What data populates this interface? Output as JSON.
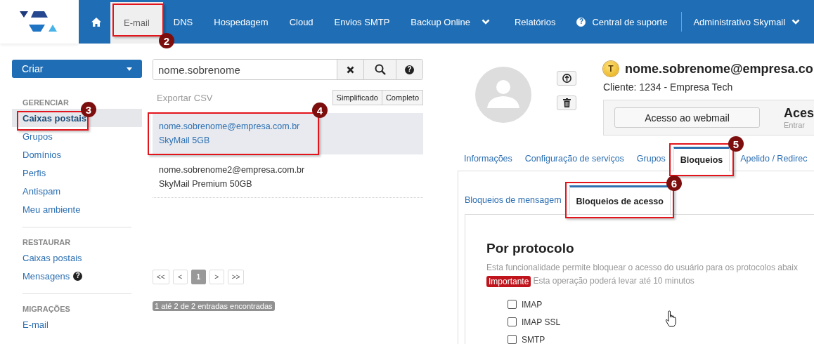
{
  "nav": {
    "items": [
      {
        "kind": "home",
        "selected": false
      },
      {
        "kind": "text",
        "label": "E-mail",
        "selected": true,
        "dropdown": false
      },
      {
        "kind": "text",
        "label": "DNS",
        "selected": false,
        "dropdown": false
      },
      {
        "kind": "text",
        "label": "Hospedagem",
        "selected": false,
        "dropdown": false
      },
      {
        "kind": "text",
        "label": "Cloud",
        "selected": false,
        "dropdown": false
      },
      {
        "kind": "text",
        "label": "Envios SMTP",
        "selected": false,
        "dropdown": false
      },
      {
        "kind": "text",
        "label": "Backup Online",
        "selected": false,
        "dropdown": true
      },
      {
        "kind": "text",
        "label": "Relatórios",
        "selected": false,
        "dropdown": false
      },
      {
        "kind": "help",
        "icon": "?",
        "label": "Central de suporte",
        "selected": false,
        "dropdown": false
      }
    ],
    "account": {
      "label": "Administrativo Skymail",
      "dropdown": true
    }
  },
  "sidebar": {
    "create_button": "Criar",
    "sections": [
      {
        "title": "GERENCIAR",
        "items": [
          {
            "label": "Caixas postais",
            "selected": true
          },
          {
            "label": "Grupos",
            "selected": false
          },
          {
            "label": "Domínios",
            "selected": false
          },
          {
            "label": "Perfis",
            "selected": false
          },
          {
            "label": "Antispam",
            "selected": false
          },
          {
            "label": "Meu ambiente",
            "selected": false
          }
        ]
      },
      {
        "title": "RESTAURAR",
        "items": [
          {
            "label": "Caixas postais",
            "selected": false
          },
          {
            "label": "Mensagens",
            "selected": false,
            "help": "?"
          }
        ]
      },
      {
        "title": "MIGRAÇÕES",
        "items": [
          {
            "label": "E-mail",
            "selected": false
          }
        ]
      }
    ]
  },
  "mailbox_list": {
    "search": {
      "value": "nome.sobrenome",
      "help_button": "?"
    },
    "export_link": "Exportar CSV",
    "view_buttons": [
      "Simplificado",
      "Completo"
    ],
    "rows": [
      {
        "email": "nome.sobrenome@empresa.com.br",
        "plan": "SkyMail 5GB",
        "selected": true
      },
      {
        "email": "nome.sobrenome2@empresa.com.br",
        "plan": "SkyMail Premium 50GB",
        "selected": false
      }
    ],
    "pagination": [
      {
        "label": "<<",
        "selected": false
      },
      {
        "label": "<",
        "selected": false
      },
      {
        "label": "1",
        "selected": true
      },
      {
        "label": ">",
        "selected": false
      },
      {
        "label": ">>",
        "selected": false
      }
    ],
    "count": "1 até 2 de 2 entradas encontradas"
  },
  "detail": {
    "status_badge": "T",
    "title": "nome.sobrenome@empresa.co",
    "client": "Cliente: 1234 - Empresa Tech",
    "webmail_button": "Acesso ao webmail",
    "access_title": "Aces",
    "access_subtitle": "Entrar",
    "tabs": [
      {
        "label": "Informações",
        "selected": false
      },
      {
        "label": "Configuração de serviços",
        "selected": false
      },
      {
        "label": "Grupos",
        "selected": false
      },
      {
        "label": "Bloqueios",
        "selected": true
      },
      {
        "label": "Apelido / Redirec",
        "selected": false
      }
    ],
    "subtabs": [
      {
        "label": "Bloqueios de mensagem",
        "selected": false
      },
      {
        "label": "Bloqueios de acesso",
        "selected": true
      }
    ],
    "section": {
      "heading": "Por protocolo",
      "description": "Esta funcionalidade permite bloquear o acesso do usuário para os protocolos abaix",
      "important_badge": "Importante",
      "important_text": "Esta operação poderá levar até 10 minutos",
      "protocols": [
        {
          "label": "IMAP",
          "checked": false
        },
        {
          "label": "IMAP SSL",
          "checked": false
        },
        {
          "label": "SMTP",
          "checked": false
        }
      ]
    }
  },
  "annotations": [
    {
      "number": "2"
    },
    {
      "number": "3"
    },
    {
      "number": "4"
    },
    {
      "number": "5"
    },
    {
      "number": "6"
    }
  ]
}
